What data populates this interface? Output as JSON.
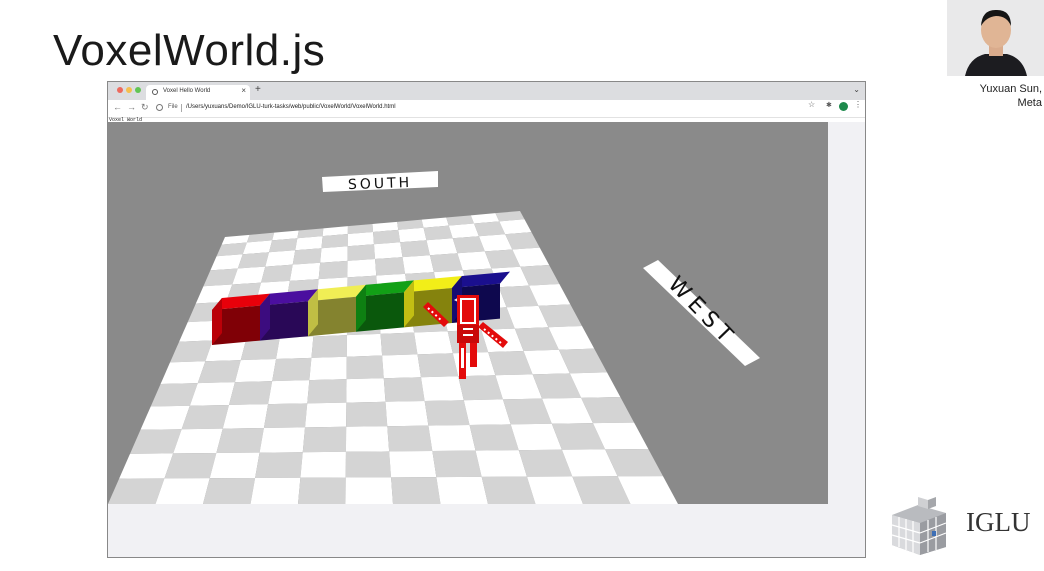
{
  "slide": {
    "title": "VoxelWorld.js",
    "speaker_line1": "Yuxuan Sun,",
    "speaker_line2": "Meta",
    "logo_text": "IGLU"
  },
  "browser": {
    "tab_title": "Voxel Hello World",
    "new_tab_symbol": "+",
    "close_symbol": "×",
    "tabs_menu_symbol": "⌄",
    "back_symbol": "←",
    "forward_symbol": "→",
    "reload_symbol": "↻",
    "scheme_label": "File",
    "url": "/Users/yuxuans/Demo/IGLU-turk-tasks/web/public/VoxelWorld/VoxelWorld.html",
    "star_symbol": "☆",
    "extensions_symbol": "✱",
    "menu_symbol": "⋮",
    "window_controls": {
      "close": "#ed6a5e",
      "minimize": "#f5bf4f",
      "maximize": "#61c554"
    }
  },
  "page": {
    "label": "Voxel World"
  },
  "scene": {
    "sign_south": "SOUTH",
    "sign_west": "WEST",
    "sky_color": "#8a8a8a",
    "floor_light": "#ffffff",
    "floor_dark": "#d4d4d4",
    "blocks": [
      {
        "name": "red",
        "color": "#e8000a"
      },
      {
        "name": "purple",
        "color": "#4b0f9f"
      },
      {
        "name": "yellow",
        "color": "#f0ee55"
      },
      {
        "name": "green",
        "color": "#12a016"
      },
      {
        "name": "yellow",
        "color": "#f2ee18"
      },
      {
        "name": "navy",
        "color": "#1a0f8e"
      }
    ],
    "agent_color": "#e30b0b"
  }
}
